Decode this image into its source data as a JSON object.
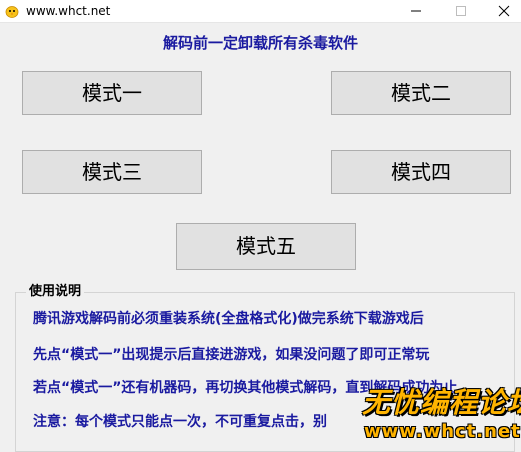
{
  "window": {
    "title": "www.whct.net",
    "icon": "chick-icon",
    "controls": [
      "minimize-icon",
      "maximize-icon",
      "close-icon"
    ]
  },
  "warning": "解码前一定卸载所有杀毒软件",
  "modes": {
    "mode1": "模式一",
    "mode2": "模式二",
    "mode3": "模式三",
    "mode4": "模式四",
    "mode5": "模式五"
  },
  "instructions": {
    "label": "使用说明",
    "lines": [
      "腾讯游戏解码前必须重装系统(全盘格式化)做完系统下载游戏后",
      "先点“模式一”出现提示后直接进游戏，如果没问题了即可正常玩",
      "若点“模式一”还有机器码，再切换其他模式解码，直到解码成功为止",
      "注意：每个模式只能点一次，不可重复点击，别"
    ]
  },
  "watermark": {
    "title": "无忧编程论坛",
    "url": "www.whct.net"
  },
  "colors": {
    "background": "#f0f0f0",
    "accent_text": "#1a1aa0",
    "button_face": "#e1e1e1",
    "watermark": "#ffb400"
  }
}
